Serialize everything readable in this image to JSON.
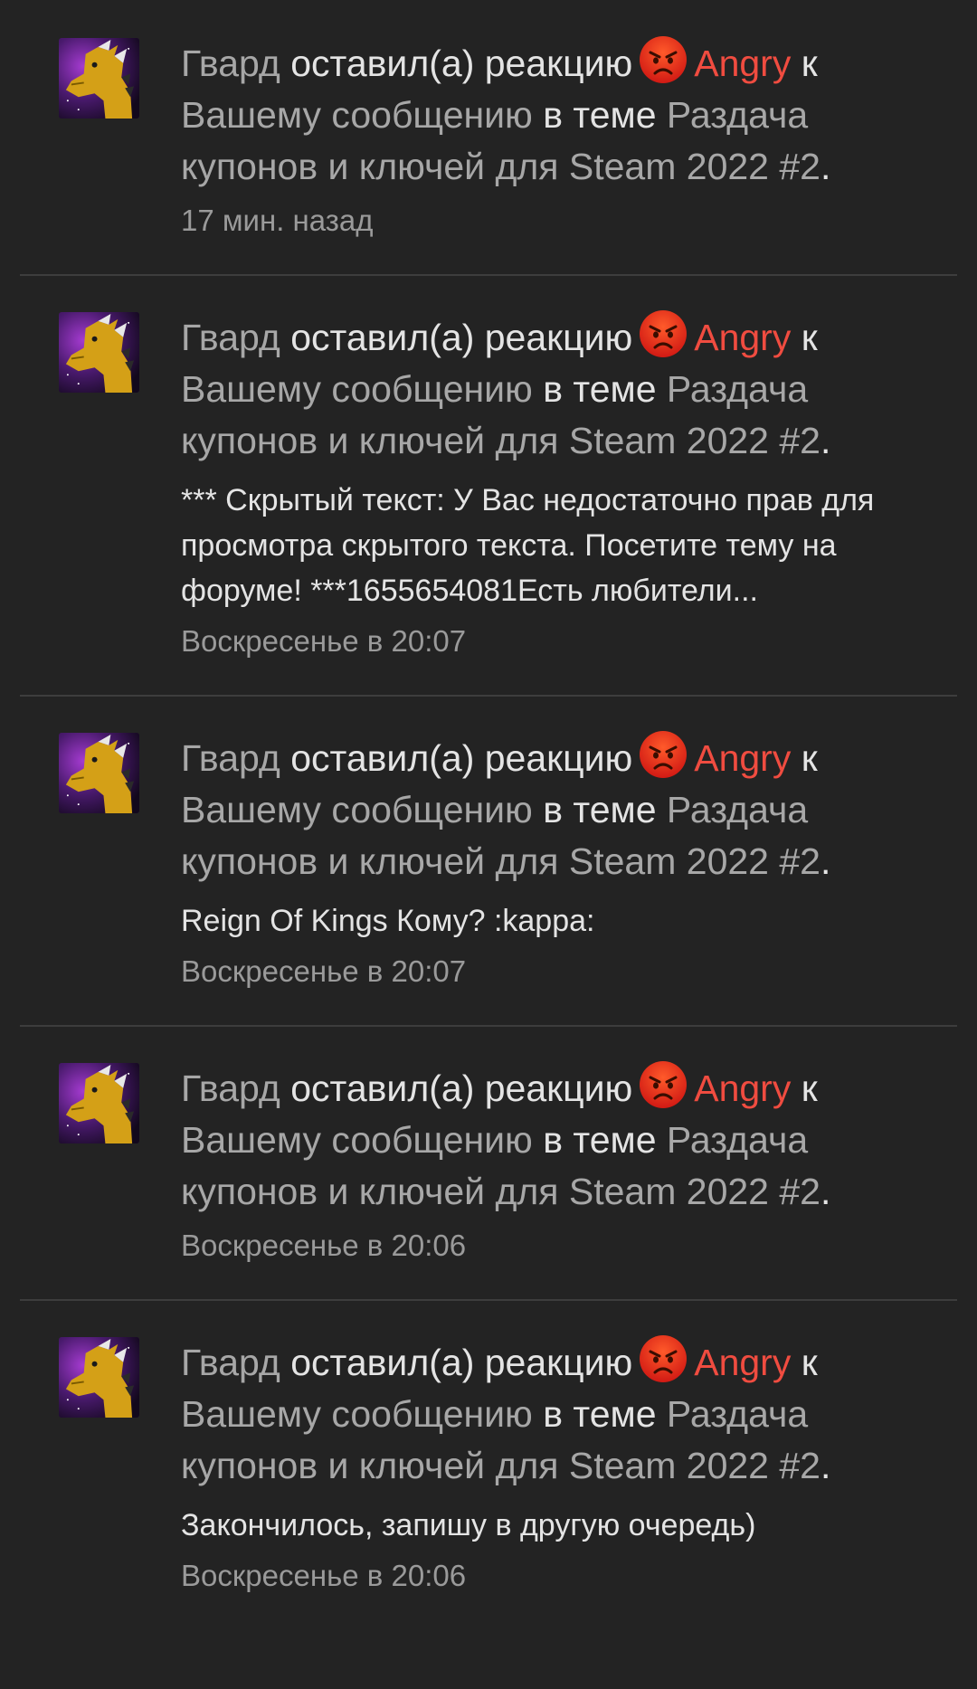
{
  "notifications": [
    {
      "user": "Гвард",
      "verb": "оставил(а) реакцию",
      "reaction": "Angry",
      "tail": "к",
      "target": "Вашему сообщению",
      "mid": "в теме",
      "thread": "Раздача купонов и ключей для Steam 2022 #2",
      "end": ".",
      "snippet": "",
      "time": "17 мин. назад"
    },
    {
      "user": "Гвард",
      "verb": "оставил(а) реакцию",
      "reaction": "Angry",
      "tail": "к",
      "target": "Вашему сообщению",
      "mid": "в теме",
      "thread": "Раздача купонов и ключей для Steam 2022 #2",
      "end": ".",
      "snippet": "*** Скрытый текст: У Вас недостаточно прав для просмотра скрытого текста. Посетите тему на форуме! ***1655654081Есть любители...",
      "time": "Воскресенье в 20:07"
    },
    {
      "user": "Гвард",
      "verb": "оставил(а) реакцию",
      "reaction": "Angry",
      "tail": "к",
      "target": "Вашему сообщению",
      "mid": "в теме",
      "thread": "Раздача купонов и ключей для Steam 2022 #2",
      "end": ".",
      "snippet": "Reign Of Kings Кому? :kappa:",
      "time": "Воскресенье в 20:07"
    },
    {
      "user": "Гвард",
      "verb": "оставил(а) реакцию",
      "reaction": "Angry",
      "tail": "к",
      "target": "Вашему сообщению",
      "mid": "в теме",
      "thread": "Раздача купонов и ключей для Steam 2022 #2",
      "end": ".",
      "snippet": "",
      "time": "Воскресенье в 20:06"
    },
    {
      "user": "Гвард",
      "verb": "оставил(а) реакцию",
      "reaction": "Angry",
      "tail": "к",
      "target": "Вашему сообщению",
      "mid": "в теме",
      "thread": "Раздача купонов и ключей для Steam 2022 #2",
      "end": ".",
      "snippet": "Закончилось, запишу в другую очередь)",
      "time": "Воскресенье в 20:06"
    }
  ],
  "icons": {
    "reaction": "angry-face-icon",
    "avatar": "dragon-avatar"
  },
  "colors": {
    "background": "#232323",
    "link": "#a7a7a7",
    "text": "#e4e4e4",
    "reaction": "#f04c40",
    "meta": "#9a9a9a",
    "divider": "#3d3d3d"
  }
}
